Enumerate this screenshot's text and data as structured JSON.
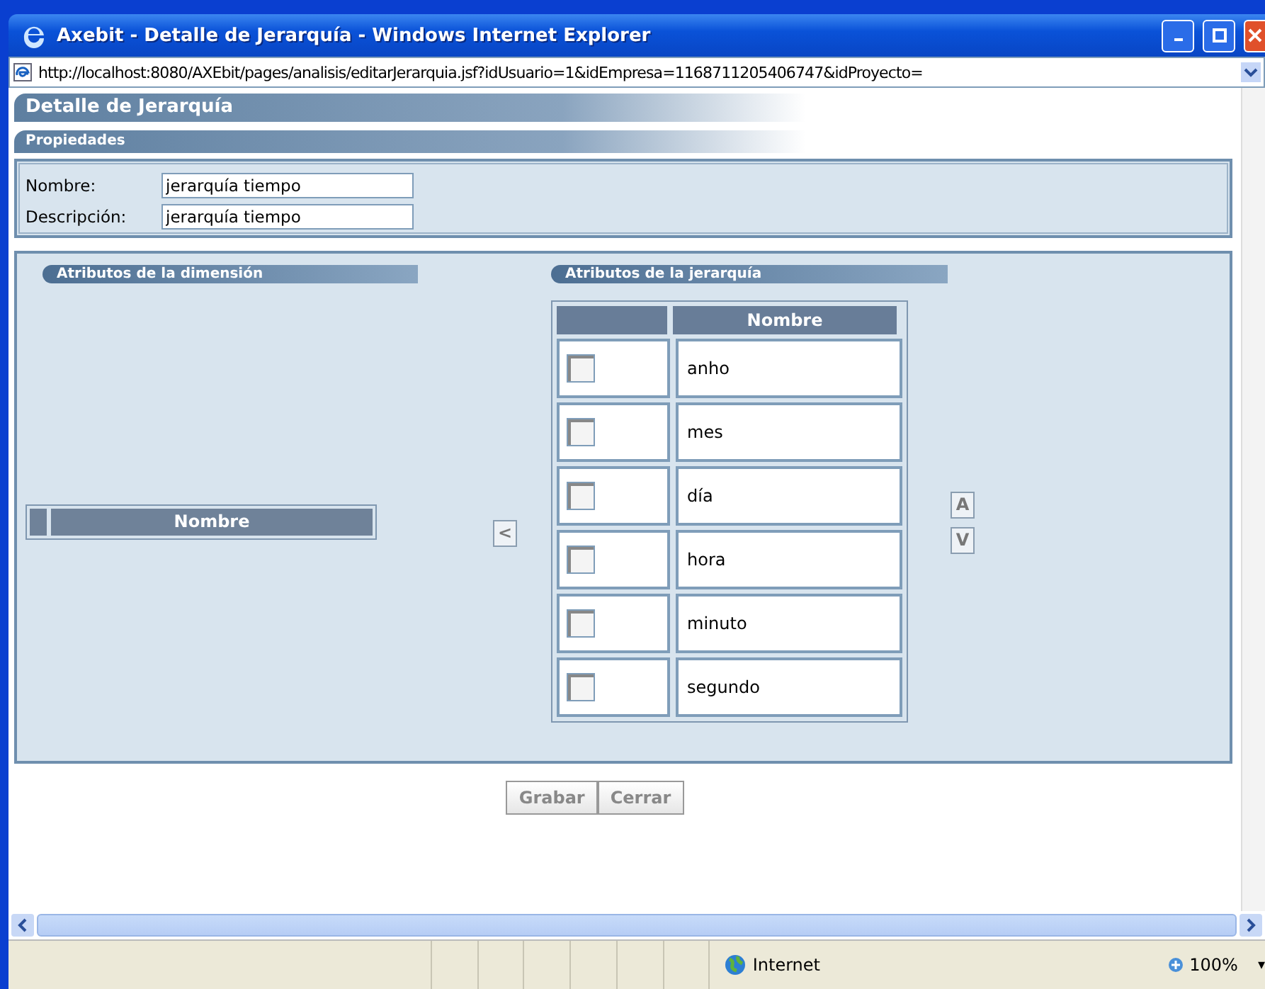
{
  "window": {
    "title": "Axebit - Detalle de Jerarquía - Windows Internet Explorer"
  },
  "address": "http://localhost:8080/AXEbit/pages/analisis/editarJerarquia.jsf?idUsuario=1&idEmpresa=1168711205406747&idProyecto=",
  "page_title": "Detalle de Jerarquía",
  "section_title": "Propiedades",
  "fields": [
    {
      "label": "Nombre:",
      "value": "jerarquía tiempo"
    },
    {
      "label": "Descripción:",
      "value": "jerarquía tiempo"
    }
  ],
  "dimension_panel": {
    "title": "Atributos de la dimensión",
    "columns": [
      "Nombre"
    ]
  },
  "move_left_button": "<",
  "hierarchy_panel": {
    "title": "Atributos de la jerarquía",
    "columns": [
      "Nombre"
    ],
    "rows": [
      {
        "name": "anho",
        "checked": false
      },
      {
        "name": "mes",
        "checked": false
      },
      {
        "name": "día",
        "checked": false
      },
      {
        "name": "hora",
        "checked": false
      },
      {
        "name": "minuto",
        "checked": false
      },
      {
        "name": "segundo",
        "checked": false
      }
    ]
  },
  "order_buttons": [
    "A",
    "V"
  ],
  "buttons": [
    "Grabar",
    "Cerrar"
  ],
  "status_bar": {
    "zone": "Internet",
    "zoom": "100%",
    "zoom_menu": "▾"
  }
}
